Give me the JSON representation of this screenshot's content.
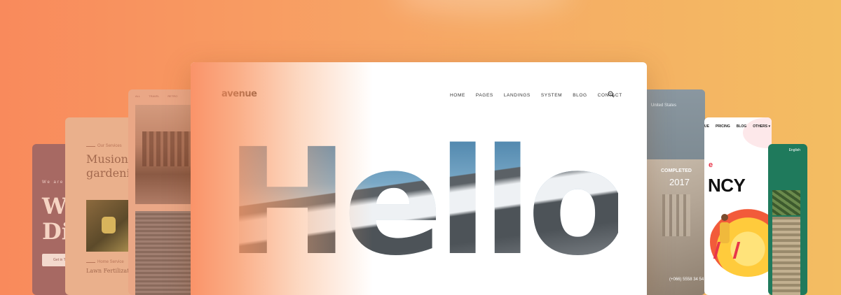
{
  "card1": {
    "small": "We are C",
    "big_line1": "W",
    "big_line2": "Di",
    "button": "Get in T"
  },
  "card2": {
    "kicker": "Our Services",
    "title_line1": "Musion",
    "title_line2": "gardeni",
    "kicker2": "Home Service",
    "link": "Lawn Fertilizatio"
  },
  "card3": {
    "tabs": [
      "ALL",
      "TRAVEL",
      "RETRO"
    ]
  },
  "card4": {
    "location": "United States",
    "label": "COMPLETED",
    "year": "2017",
    "phone": "(+066) 5558 34 54"
  },
  "card5": {
    "nav": [
      "UE",
      "PRICING",
      "BLOG",
      "OTHERS ▾"
    ],
    "red_text": "e",
    "big_text": "NCY"
  },
  "card6": {
    "lang": "English"
  },
  "main": {
    "logo": "avenue",
    "nav": [
      "HOME",
      "PAGES",
      "LANDINGS",
      "SYSTEM",
      "BLOG",
      "CONTACT"
    ],
    "hero": "Hello!"
  },
  "colors": {
    "background_start": "#f98a5c",
    "background_end": "#f3bd62",
    "accent_red": "#e8364a",
    "green_card": "#1f7a5c"
  }
}
